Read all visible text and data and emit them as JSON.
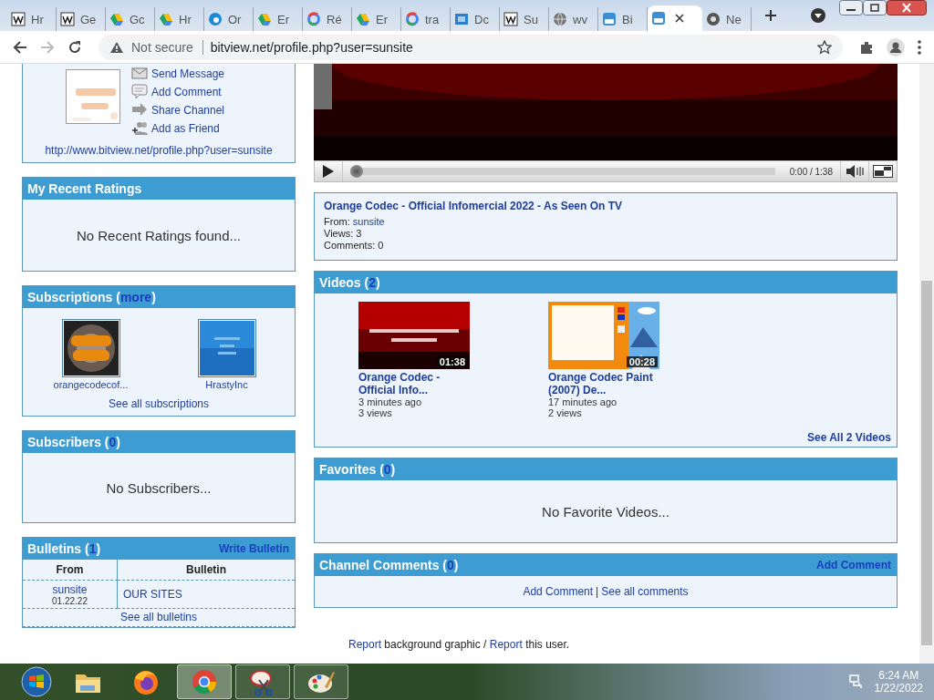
{
  "browser": {
    "tabs": [
      {
        "kind": "wiki",
        "label": "Hr",
        "selected": false
      },
      {
        "kind": "wiki",
        "label": "Ge",
        "selected": false
      },
      {
        "kind": "drive",
        "label": "Gc",
        "selected": false
      },
      {
        "kind": "drive",
        "label": "Hr",
        "selected": false
      },
      {
        "kind": "edge",
        "label": "Or",
        "selected": false
      },
      {
        "kind": "drive",
        "label": "Er",
        "selected": false
      },
      {
        "kind": "google",
        "label": "Ré",
        "selected": false
      },
      {
        "kind": "drive",
        "label": "Er",
        "selected": false
      },
      {
        "kind": "google",
        "label": "tra",
        "selected": false
      },
      {
        "kind": "sf",
        "label": "Dc",
        "selected": false
      },
      {
        "kind": "wiki",
        "label": "Su",
        "selected": false
      },
      {
        "kind": "globe",
        "label": "wv",
        "selected": false
      },
      {
        "kind": "bitview",
        "label": "Bi",
        "selected": false
      },
      {
        "kind": "bitview",
        "selected": true
      },
      {
        "kind": "chrome",
        "label": "Ne",
        "selected": false
      }
    ],
    "address": {
      "security": "Not secure",
      "url": "bitview.net/profile.php?user=sunsite"
    }
  },
  "profile": {
    "actions": [
      {
        "kind": "message",
        "label": "Send Message"
      },
      {
        "kind": "comment",
        "label": "Add Comment"
      },
      {
        "kind": "share",
        "label": "Share Channel"
      },
      {
        "kind": "friend",
        "label": "Add as Friend"
      }
    ],
    "url": "http://www.bitview.net/profile.php?user=sunsite"
  },
  "ratings": {
    "label": "My Recent Ratings",
    "empty": "No Recent Ratings found..."
  },
  "subscriptions": {
    "label": "Subscriptions (",
    "count": "more",
    "close": ")",
    "items": [
      {
        "name": "orangecodecof...",
        "kind": "picture"
      },
      {
        "name": "HrastyInc",
        "kind": "picture"
      }
    ],
    "see_all": "See all subscriptions"
  },
  "subscribers": {
    "label": "Subscribers (",
    "count": "0",
    "close": ")",
    "empty": "No Subscribers..."
  },
  "bulletins": {
    "label": "Bulletins (",
    "count": "1",
    "close": ")",
    "action": "Write Bulletin",
    "columns": [
      "From",
      "Bulletin"
    ],
    "rows": [
      {
        "from": "sunsite",
        "date": "01.22.22",
        "bulletin": "OUR SITES"
      }
    ],
    "see_all": "See all bulletins"
  },
  "player": {
    "time": "0:00 / 1:38",
    "level": 0
  },
  "video_info": {
    "title": "Orange Codec - Official Infomercial 2022 - As Seen On TV",
    "from_label": "From: ",
    "from": "sunsite",
    "views": "Views: 3",
    "comments": "Comments: 0"
  },
  "videos": {
    "label": "Videos (",
    "count": "2",
    "close": ")",
    "items": [
      {
        "kind": "picture",
        "duration": "01:38",
        "title": "Orange Codec - Official Info...",
        "age": "3 minutes ago",
        "views": "3 views"
      },
      {
        "kind": "picture",
        "duration": "00:28",
        "title": "Orange Codec Paint (2007) De...",
        "age": "17 minutes ago",
        "views": "2 views"
      }
    ],
    "see_all": "See All 2 Videos"
  },
  "favorites": {
    "label": "Favorites (",
    "count": "0",
    "close": ")",
    "empty": "No Favorite Videos..."
  },
  "channel_comments": {
    "label": "Channel Comments (",
    "count": "0",
    "close": ")",
    "action": "Add Comment",
    "links": [
      "Add Comment",
      "See all comments"
    ],
    "separator": "|"
  },
  "footer": {
    "first_link": "Report",
    "middle": " background graphic / ",
    "second_link": "Report",
    "end": " this user."
  },
  "taskbar": {
    "apps": [
      {
        "kind": "explorer",
        "running": false,
        "selected": false
      },
      {
        "kind": "firefox",
        "running": false,
        "selected": false
      },
      {
        "kind": "chrome",
        "running": true,
        "selected": true
      },
      {
        "kind": "snip",
        "running": true,
        "selected": false
      },
      {
        "kind": "paint",
        "running": true,
        "selected": false
      }
    ],
    "time": "6:24 AM",
    "date": "1/22/2022"
  }
}
